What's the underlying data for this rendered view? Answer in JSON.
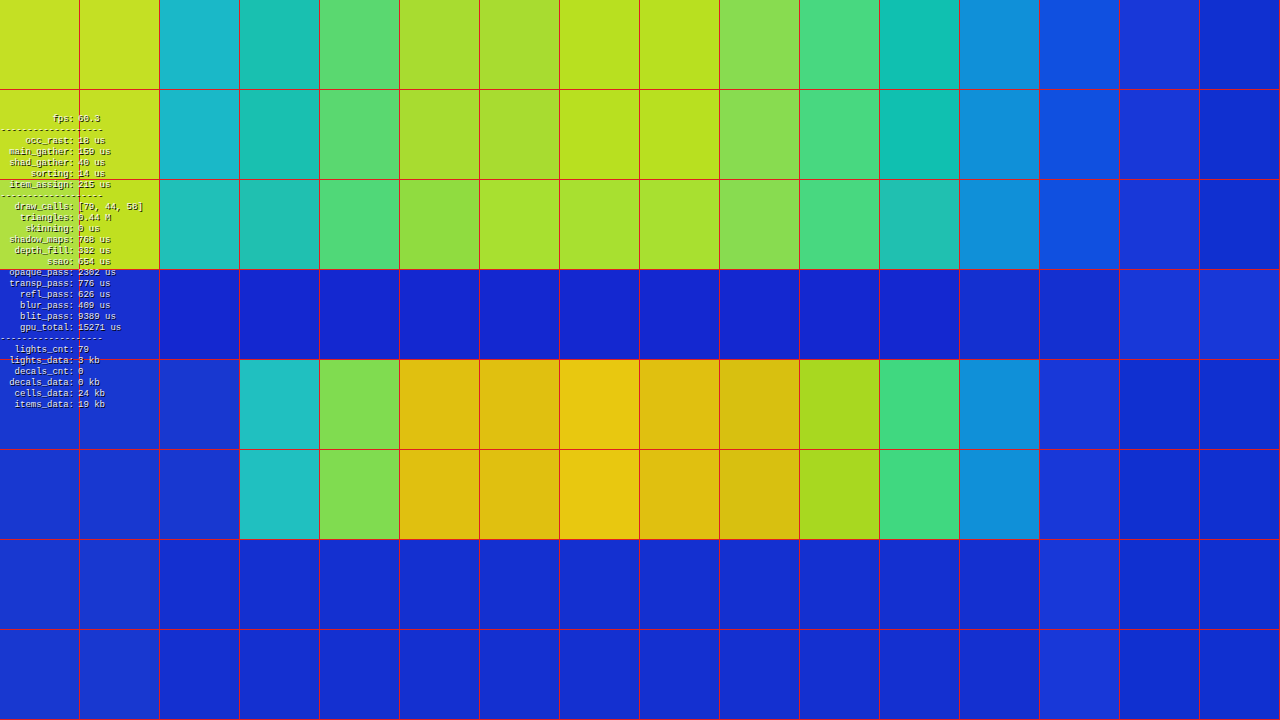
{
  "heatmap": {
    "rows": [
      [
        {
          "color": "#c4e024"
        },
        {
          "color": "#c4e024"
        },
        {
          "color": "#1ab8c8"
        },
        {
          "color": "#19c0b0"
        },
        {
          "color": "#5ad870"
        },
        {
          "color": "#a8dc30"
        },
        {
          "color": "#a8dc30"
        },
        {
          "color": "#b8e020"
        },
        {
          "color": "#b8e020"
        },
        {
          "color": "#88dc50"
        },
        {
          "color": "#48d880"
        },
        {
          "color": "#10c0b0"
        },
        {
          "color": "#1090d8"
        },
        {
          "color": "#1050e0"
        },
        {
          "color": "#1838d8"
        },
        {
          "color": "#1030d0"
        }
      ],
      [
        {
          "color": "#c4e024"
        },
        {
          "color": "#c4e024"
        },
        {
          "color": "#1ab8c8"
        },
        {
          "color": "#19c0b0"
        },
        {
          "color": "#5ad870"
        },
        {
          "color": "#a8dc30"
        },
        {
          "color": "#a8dc30"
        },
        {
          "color": "#b8e020"
        },
        {
          "color": "#b8e020"
        },
        {
          "color": "#88dc50"
        },
        {
          "color": "#48d880"
        },
        {
          "color": "#10c0b0"
        },
        {
          "color": "#1090d8"
        },
        {
          "color": "#1050e0"
        },
        {
          "color": "#1838d8"
        },
        {
          "color": "#1030d0"
        }
      ],
      [
        {
          "color": "#b0e040"
        },
        {
          "color": "#c0e020"
        },
        {
          "color": "#20c0b8"
        },
        {
          "color": "#20c0b0"
        },
        {
          "color": "#50d878"
        },
        {
          "color": "#90dc40"
        },
        {
          "color": "#a8e030"
        },
        {
          "color": "#a8e030"
        },
        {
          "color": "#a8e030"
        },
        {
          "color": "#88dc50"
        },
        {
          "color": "#48d880"
        },
        {
          "color": "#20c0b0"
        },
        {
          "color": "#1090d8"
        },
        {
          "color": "#1050e0"
        },
        {
          "color": "#1838d8"
        },
        {
          "color": "#1030d0"
        }
      ],
      [
        {
          "color": "#1830d0"
        },
        {
          "color": "#1830d0"
        },
        {
          "color": "#1428d0"
        },
        {
          "color": "#1428d0"
        },
        {
          "color": "#1428d0"
        },
        {
          "color": "#1428d0"
        },
        {
          "color": "#1428d0"
        },
        {
          "color": "#1428d0"
        },
        {
          "color": "#1428d0"
        },
        {
          "color": "#1428d0"
        },
        {
          "color": "#1428d0"
        },
        {
          "color": "#1428d0"
        },
        {
          "color": "#1430d0"
        },
        {
          "color": "#1430d0"
        },
        {
          "color": "#1838d8"
        },
        {
          "color": "#1838d8"
        }
      ],
      [
        {
          "color": "#1838d0"
        },
        {
          "color": "#1838d0"
        },
        {
          "color": "#1838d0"
        },
        {
          "color": "#20c0c0"
        },
        {
          "color": "#80dc50"
        },
        {
          "color": "#e0c010"
        },
        {
          "color": "#e0c010"
        },
        {
          "color": "#e8c810"
        },
        {
          "color": "#e0c010"
        },
        {
          "color": "#d8c010"
        },
        {
          "color": "#a8d820"
        },
        {
          "color": "#40d880"
        },
        {
          "color": "#1090d8"
        },
        {
          "color": "#1838d8"
        },
        {
          "color": "#1030d0"
        },
        {
          "color": "#1030d0"
        }
      ],
      [
        {
          "color": "#1838d0"
        },
        {
          "color": "#1838d0"
        },
        {
          "color": "#1838d0"
        },
        {
          "color": "#20c0c0"
        },
        {
          "color": "#80dc50"
        },
        {
          "color": "#e0c010"
        },
        {
          "color": "#e0c010"
        },
        {
          "color": "#e8c810"
        },
        {
          "color": "#e0c010"
        },
        {
          "color": "#d8c010"
        },
        {
          "color": "#a8d820"
        },
        {
          "color": "#40d880"
        },
        {
          "color": "#1090d8"
        },
        {
          "color": "#1838d8"
        },
        {
          "color": "#1030d0"
        },
        {
          "color": "#1030d0"
        }
      ],
      [
        {
          "color": "#1838d0"
        },
        {
          "color": "#1838d0"
        },
        {
          "color": "#1430d0"
        },
        {
          "color": "#1430d0"
        },
        {
          "color": "#1430d0"
        },
        {
          "color": "#1430d0"
        },
        {
          "color": "#1430d0"
        },
        {
          "color": "#1430d0"
        },
        {
          "color": "#1430d0"
        },
        {
          "color": "#1430d0"
        },
        {
          "color": "#1430d0"
        },
        {
          "color": "#1430d0"
        },
        {
          "color": "#1430d0"
        },
        {
          "color": "#1838d8"
        },
        {
          "color": "#1030d0"
        },
        {
          "color": "#1030d0"
        }
      ],
      [
        {
          "color": "#1838d0"
        },
        {
          "color": "#1838d0"
        },
        {
          "color": "#1430d0"
        },
        {
          "color": "#1430d0"
        },
        {
          "color": "#1430d0"
        },
        {
          "color": "#1430d0"
        },
        {
          "color": "#1430d0"
        },
        {
          "color": "#1430d0"
        },
        {
          "color": "#1430d0"
        },
        {
          "color": "#1430d0"
        },
        {
          "color": "#1430d0"
        },
        {
          "color": "#1430d0"
        },
        {
          "color": "#1430d0"
        },
        {
          "color": "#1838d8"
        },
        {
          "color": "#1030d0"
        },
        {
          "color": "#1030d0"
        }
      ]
    ]
  },
  "stats": [
    {
      "kind": "stat",
      "label": "fps:",
      "value": "60.3"
    },
    {
      "kind": "separator",
      "text": "-------------------"
    },
    {
      "kind": "stat",
      "label": "occ_rast:",
      "value": "18 us"
    },
    {
      "kind": "stat",
      "label": "main_gather:",
      "value": "159 us"
    },
    {
      "kind": "stat",
      "label": "shad_gather:",
      "value": "40 us"
    },
    {
      "kind": "stat",
      "label": "sorting:",
      "value": "14 us"
    },
    {
      "kind": "stat",
      "label": "item_assign:",
      "value": "215 us"
    },
    {
      "kind": "separator",
      "text": "-------------------"
    },
    {
      "kind": "stat",
      "label": "draw_calls:",
      "value": "[79, 44, 58]"
    },
    {
      "kind": "stat",
      "label": "triangles:",
      "value": "0.44 M"
    },
    {
      "kind": "stat",
      "label": "skinning:",
      "value": "0 us"
    },
    {
      "kind": "stat",
      "label": "shadow_maps:",
      "value": "768 us"
    },
    {
      "kind": "stat",
      "label": "depth_fill:",
      "value": "332 us"
    },
    {
      "kind": "stat",
      "label": "ssao:",
      "value": "654 us"
    },
    {
      "kind": "stat",
      "label": "opaque_pass:",
      "value": "2302 us"
    },
    {
      "kind": "stat",
      "label": "transp_pass:",
      "value": "776 us"
    },
    {
      "kind": "stat",
      "label": "refl_pass:",
      "value": "626 us"
    },
    {
      "kind": "stat",
      "label": "blur_pass:",
      "value": "409 us"
    },
    {
      "kind": "stat",
      "label": "blit_pass:",
      "value": "9389 us"
    },
    {
      "kind": "stat",
      "label": "gpu_total:",
      "value": "15271 us"
    },
    {
      "kind": "separator",
      "text": "-------------------"
    },
    {
      "kind": "stat",
      "label": "lights_cnt:",
      "value": "79"
    },
    {
      "kind": "stat",
      "label": "lights_data:",
      "value": "3 kb"
    },
    {
      "kind": "stat",
      "label": "decals_cnt:",
      "value": "0"
    },
    {
      "kind": "stat",
      "label": "decals_data:",
      "value": "0 kb"
    },
    {
      "kind": "stat",
      "label": "cells_data:",
      "value": "24 kb"
    },
    {
      "kind": "stat",
      "label": "items_data:",
      "value": "19 kb"
    }
  ]
}
